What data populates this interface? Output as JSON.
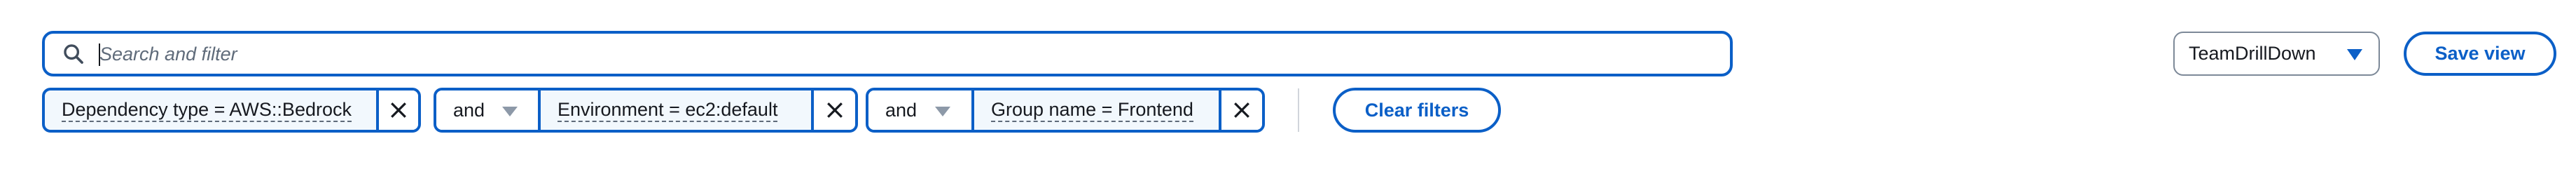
{
  "search": {
    "placeholder": "Search and filter",
    "value": ""
  },
  "view_select": {
    "selected": "TeamDrillDown"
  },
  "save_view_label": "Save view",
  "filters": [
    {
      "operator": "",
      "text": "Dependency type = AWS::Bedrock"
    },
    {
      "operator": "and",
      "text": "Environment = ec2:default"
    },
    {
      "operator": "and",
      "text": "Group name = Frontend"
    }
  ],
  "clear_filters_label": "Clear filters",
  "colors": {
    "accent": "#0b5fc7",
    "token_fill": "#f2f8fd",
    "border_neutral": "#7d8998",
    "text": "#16191f"
  },
  "icons": {
    "search": "search-icon",
    "view_dropdown": "chevron-down-icon",
    "operator_dropdown": "caret-down-icon",
    "dismiss": "close-icon"
  }
}
